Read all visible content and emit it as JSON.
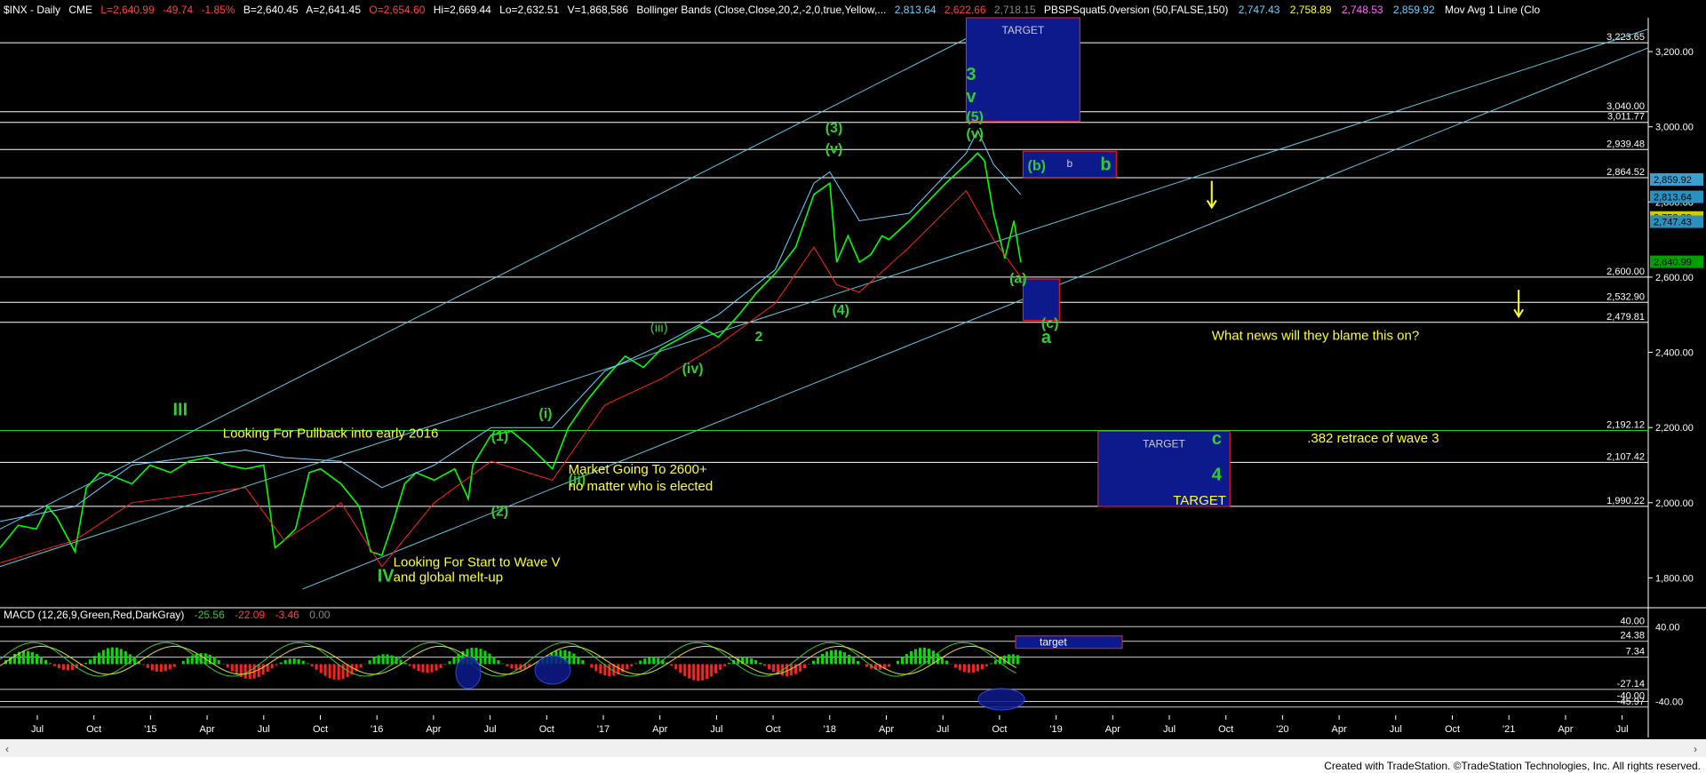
{
  "header": {
    "symbol": "$INX - Daily",
    "exchange": "CME",
    "last": "L=2,640.99",
    "change": "-49.74",
    "change_pct": "-1.85%",
    "bid": "B=2,640.45",
    "ask": "A=2,641.45",
    "open": "O=2,654.60",
    "high": "Hi=2,669.44",
    "low": "Lo=2,632.51",
    "volume": "V=1,868,586",
    "bb_label": "Bollinger Bands (Close,Close,20,2,-2,0,true,Yellow,...",
    "bb_val1": "2,813.64",
    "bb_val2": "2,622.66",
    "bb_val3": "2,718.15",
    "pbs_label": "PBSPSquat5.0version (50,FALSE,150)",
    "pbs_val1": "2,747.43",
    "pbs_val2": "2,758.89",
    "pbs_val3": "2,748.53",
    "pbs_val4": "2,859.92",
    "ma_label": "Mov Avg 1 Line (Clo"
  },
  "macd_header": {
    "label": "MACD (12,26,9,Green,Red,DarkGray)",
    "v1": "-25.56",
    "v2": "-22.09",
    "v3": "-3.46",
    "v4": "0.00"
  },
  "footer": {
    "credit": "Created with TradeStation. ©TradeStation Technologies, Inc. All rights reserved."
  },
  "colors": {
    "price": "#00ff00",
    "bb_lower": "#ff2020",
    "bb_upper": "#6fd0ff",
    "channel": "#5fc8e0",
    "box_fill": "#0d1a8c",
    "box_border": "#ff2020",
    "wave_label": "#33cc33",
    "yellow": "#ffff33",
    "macd_pos": "#00e000",
    "macd_neg": "#ff2020"
  },
  "chart_data": {
    "type": "line",
    "title": "$INX - Daily",
    "x_ticks": [
      "Jul",
      "Oct",
      "'15",
      "Apr",
      "Jul",
      "Oct",
      "'16",
      "Apr",
      "Jul",
      "Oct",
      "'17",
      "Apr",
      "Jul",
      "Oct",
      "'18",
      "Apr",
      "Jul",
      "Oct",
      "'19",
      "Apr",
      "Jul",
      "Oct",
      "'20",
      "Apr",
      "Jul",
      "Oct",
      "'21",
      "Apr",
      "Jul"
    ],
    "y_ticks": [
      "1,800.00",
      "2,000.00",
      "2,200.00",
      "2,400.00",
      "2,600.00",
      "2,800.00",
      "3,000.00",
      "3,200.00"
    ],
    "ylim": [
      1730,
      3290
    ],
    "xlim": [
      2014.42,
      2021.67
    ],
    "series": [
      {
        "x": [
          2014.42,
          2014.5,
          2014.58,
          2014.63,
          2014.67,
          2014.75,
          2014.8,
          2014.86,
          2014.92,
          2015.0,
          2015.08,
          2015.17,
          2015.25,
          2015.33,
          2015.42,
          2015.5,
          2015.58,
          2015.63,
          2015.67,
          2015.72,
          2015.78,
          2015.83,
          2015.92,
          2016.0,
          2016.05,
          2016.1,
          2016.15,
          2016.2,
          2016.25,
          2016.33,
          2016.42,
          2016.48,
          2016.5,
          2016.58,
          2016.67,
          2016.75,
          2016.85,
          2016.92,
          2017.0,
          2017.08,
          2017.17,
          2017.25,
          2017.33,
          2017.42,
          2017.5,
          2017.58,
          2017.67,
          2017.75,
          2017.83,
          2017.92,
          2018.0,
          2018.07,
          2018.1,
          2018.15,
          2018.2,
          2018.25,
          2018.3,
          2018.33,
          2018.42,
          2018.5,
          2018.58,
          2018.67,
          2018.72,
          2018.75,
          2018.79,
          2018.84,
          2018.88,
          2018.91
        ],
        "values": [
          1880,
          1940,
          1930,
          1990,
          1960,
          1870,
          2040,
          2080,
          2070,
          2050,
          2100,
          2080,
          2110,
          2120,
          2100,
          2090,
          2100,
          1880,
          1900,
          1930,
          2080,
          2090,
          2050,
          1990,
          1870,
          1860,
          1950,
          2050,
          2080,
          2060,
          2090,
          2010,
          2100,
          2180,
          2190,
          2150,
          2090,
          2200,
          2270,
          2330,
          2390,
          2360,
          2410,
          2440,
          2470,
          2440,
          2500,
          2560,
          2610,
          2680,
          2820,
          2850,
          2640,
          2710,
          2640,
          2660,
          2710,
          2700,
          2750,
          2800,
          2850,
          2900,
          2930,
          2910,
          2770,
          2650,
          2750,
          2640
        ]
      },
      {
        "name": "lower",
        "x": [
          2014.42,
          2014.75,
          2015.0,
          2015.5,
          2015.67,
          2015.92,
          2016.1,
          2016.33,
          2016.58,
          2016.85,
          2017.08,
          2017.33,
          2017.58,
          2017.83,
          2018.0,
          2018.1,
          2018.2,
          2018.42,
          2018.67,
          2018.79,
          2018.91
        ],
        "values": [
          1840,
          1900,
          2000,
          2040,
          1900,
          2000,
          1830,
          2000,
          2110,
          2060,
          2260,
          2330,
          2420,
          2530,
          2680,
          2580,
          2560,
          2680,
          2830,
          2700,
          2600
        ]
      },
      {
        "name": "upper",
        "x": [
          2014.42,
          2014.75,
          2015.0,
          2015.5,
          2015.67,
          2015.92,
          2016.1,
          2016.33,
          2016.58,
          2016.85,
          2017.08,
          2017.33,
          2017.58,
          2017.83,
          2018.0,
          2018.07,
          2018.2,
          2018.42,
          2018.67,
          2018.72,
          2018.79,
          2018.91
        ],
        "values": [
          1950,
          1990,
          2100,
          2140,
          2120,
          2110,
          2040,
          2100,
          2200,
          2200,
          2350,
          2420,
          2500,
          2620,
          2850,
          2880,
          2750,
          2770,
          2930,
          2990,
          2900,
          2820
        ]
      }
    ],
    "horizontal_levels": [
      "3,223.65",
      "3,040.00",
      "3,011.77",
      "2,939.48",
      "2,864.52",
      "2,600.00",
      "2,532.90",
      "2,479.81",
      "2,192.12",
      "2,107.42",
      "1,990.22"
    ],
    "price_tags": [
      "2,859.92",
      "2,813.64",
      "2,758.89",
      "2,747.43",
      "2,640.99"
    ],
    "target_boxes": [
      {
        "label": "TARGET",
        "x": [
          2018.67,
          2019.17
        ],
        "y": [
          3015,
          3290
        ]
      },
      {
        "label": "b",
        "x": [
          2018.92,
          2019.33
        ],
        "y": [
          2865,
          2935
        ]
      },
      {
        "label": "",
        "x": [
          2018.92,
          2019.08
        ],
        "y": [
          2485,
          2595
        ]
      },
      {
        "label": "TARGET",
        "x": [
          2019.25,
          2019.83
        ],
        "y": [
          1990,
          2190
        ]
      }
    ],
    "annotations": [
      {
        "text": "III",
        "x": 2015.18,
        "y": 2232,
        "color": "#33cc33"
      },
      {
        "text": "Looking For Pullback into early 2016",
        "x": 2015.4,
        "y": 2173,
        "color": "#ffff33"
      },
      {
        "text": "(1)",
        "x": 2016.58,
        "y": 2165,
        "color": "#33cc33"
      },
      {
        "text": "(i)",
        "x": 2016.79,
        "y": 2225,
        "color": "#33cc33"
      },
      {
        "text": "(ii)",
        "x": 2016.92,
        "y": 2050,
        "color": "#33cc33"
      },
      {
        "text": "(2)",
        "x": 2016.58,
        "y": 1965,
        "color": "#33cc33"
      },
      {
        "text": "Market Going To 2600+",
        "x": 2016.92,
        "y": 2077,
        "color": "#ffff33"
      },
      {
        "text": "no matter who is elected",
        "x": 2016.92,
        "y": 2033,
        "color": "#ffff33"
      },
      {
        "text": "IV",
        "x": 2016.08,
        "y": 1790,
        "color": "#33cc33"
      },
      {
        "text": "Looking For Start to Wave V",
        "x": 2016.15,
        "y": 1830,
        "color": "#ffff33"
      },
      {
        "text": "and global melt-up",
        "x": 2016.15,
        "y": 1790,
        "color": "#ffff33"
      },
      {
        "text": "(iii)",
        "x": 2017.28,
        "y": 2455,
        "color": "#33cc33"
      },
      {
        "text": "(iv)",
        "x": 2017.42,
        "y": 2345,
        "color": "#33cc33"
      },
      {
        "text": "2",
        "x": 2017.74,
        "y": 2430,
        "color": "#33cc33"
      },
      {
        "text": "(3)",
        "x": 2018.05,
        "y": 2985,
        "color": "#33cc33"
      },
      {
        "text": "(v)",
        "x": 2018.05,
        "y": 2930,
        "color": "#33cc33"
      },
      {
        "text": "(4)",
        "x": 2018.08,
        "y": 2500,
        "color": "#33cc33"
      },
      {
        "text": "(5)",
        "x": 2018.67,
        "y": 3015,
        "color": "#33cc33"
      },
      {
        "text": "(v)",
        "x": 2018.67,
        "y": 2970,
        "color": "#33cc33"
      },
      {
        "text": "3",
        "x": 2018.67,
        "y": 3125,
        "color": "#33cc33"
      },
      {
        "text": "v",
        "x": 2018.67,
        "y": 3065,
        "color": "#33cc33"
      },
      {
        "text": "(b)",
        "x": 2018.94,
        "y": 2885,
        "color": "#33cc33"
      },
      {
        "text": "b",
        "x": 2019.26,
        "y": 2885,
        "color": "#33cc33"
      },
      {
        "text": "(a)",
        "x": 2018.86,
        "y": 2585,
        "color": "#33cc33"
      },
      {
        "text": "(c)",
        "x": 2019.0,
        "y": 2465,
        "color": "#33cc33"
      },
      {
        "text": "a",
        "x": 2019.0,
        "y": 2425,
        "color": "#33cc33"
      },
      {
        "text": "What news will they blame this on?",
        "x": 2019.75,
        "y": 2433,
        "color": "#ffff33"
      },
      {
        "text": "c",
        "x": 2019.75,
        "y": 2155,
        "color": "#33cc33"
      },
      {
        "text": "4",
        "x": 2019.75,
        "y": 2060,
        "color": "#33cc33"
      },
      {
        "text": ".382 retrace of wave 3",
        "x": 2020.17,
        "y": 2160,
        "color": "#ffff33"
      },
      {
        "text": "TARGET",
        "x": 2019.58,
        "y": 1995,
        "color": "#ffff33"
      }
    ],
    "macd": {
      "y_ticks": [
        "40.00",
        "24.38",
        "7.34",
        "-27.14",
        "-45.97",
        "-40.00"
      ],
      "ylim": [
        -50,
        45
      ],
      "target_label": "target"
    }
  }
}
